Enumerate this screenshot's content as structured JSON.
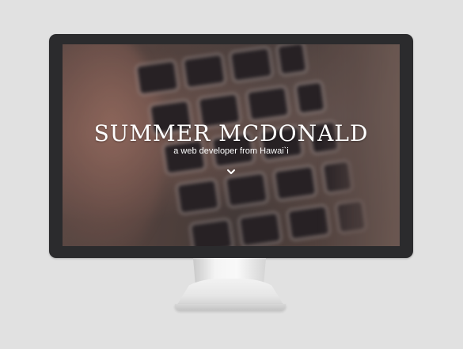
{
  "site": {
    "title": "SUMMER MCDONALD",
    "subtitle": "a web developer from Hawai`i",
    "scroll_icon": "chevron-down-icon"
  },
  "colors": {
    "background": "#e1e1e1",
    "bezel": "#2b2b2d",
    "hero_text": "#ffffff"
  }
}
